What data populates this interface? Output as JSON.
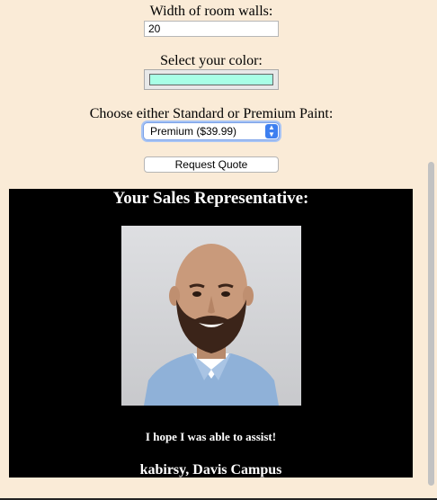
{
  "form": {
    "width_label": "Width of room walls:",
    "width_value": "20",
    "color_label": "Select your color:",
    "color_value": "#a8ffe6",
    "paint_label": "Choose either Standard or Premium Paint:",
    "paint_selected": "Premium ($39.99)",
    "quote_button": "Request Quote"
  },
  "rep": {
    "title": "Your Sales Representative:",
    "message": "I hope I was able to assist!",
    "name": "kabirsy, Davis Campus"
  },
  "colors": {
    "page_background": "#faebd7",
    "panel_background": "#000000"
  }
}
